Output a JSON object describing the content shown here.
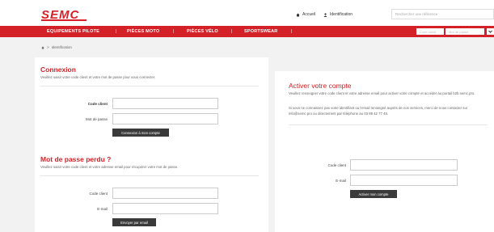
{
  "header": {
    "logo": "SEMC",
    "accueil": "Accueil",
    "identification": "Identification",
    "search_placeholder": "Rechercher une référence"
  },
  "nav": {
    "items": [
      "EQUIPEMENTS PILOTE",
      "PIÈCES MOTO",
      "PIÈCES VÉLO",
      "SPORTSWEAR"
    ],
    "code_client_placeholder": "Code client",
    "password_placeholder": "Mot de passe"
  },
  "breadcrumb": {
    "current": "Identification"
  },
  "login": {
    "title": "Connexion",
    "description": "Veuillez saisir votre code client et votre mot de passe pour vous connecter.",
    "code_label": "Code client",
    "password_label": "Mot de passe",
    "button": "Connexion à mon compte"
  },
  "lost": {
    "title": "Mot de passe perdu ?",
    "description": "Veuillez saisir votre code client et votre adresse email pour récupérer votre mot de passe.",
    "code_label": "Code client",
    "email_label": "E-mail",
    "button": "Envoyer par email"
  },
  "activate": {
    "title": "Activer votre compte",
    "description1": "Veuillez renseigner votre code client et votre adresse email pour activer votre compte et accéder au portail b2b.semc.pro.",
    "description2": "Si vous ne connaissez pas votre identifiant ou l'email renseigné auprès de nos services, merci de nous contacter sur info@semc.pro ou directement par téléphone au 03 89 42 77 45.",
    "code_label": "Code client",
    "email_label": "E-mail",
    "button": "Activer mon compte"
  },
  "colors": {
    "brand_red": "#d42128",
    "button_dark": "#3a3a3a",
    "background": "#f2f2f2"
  }
}
